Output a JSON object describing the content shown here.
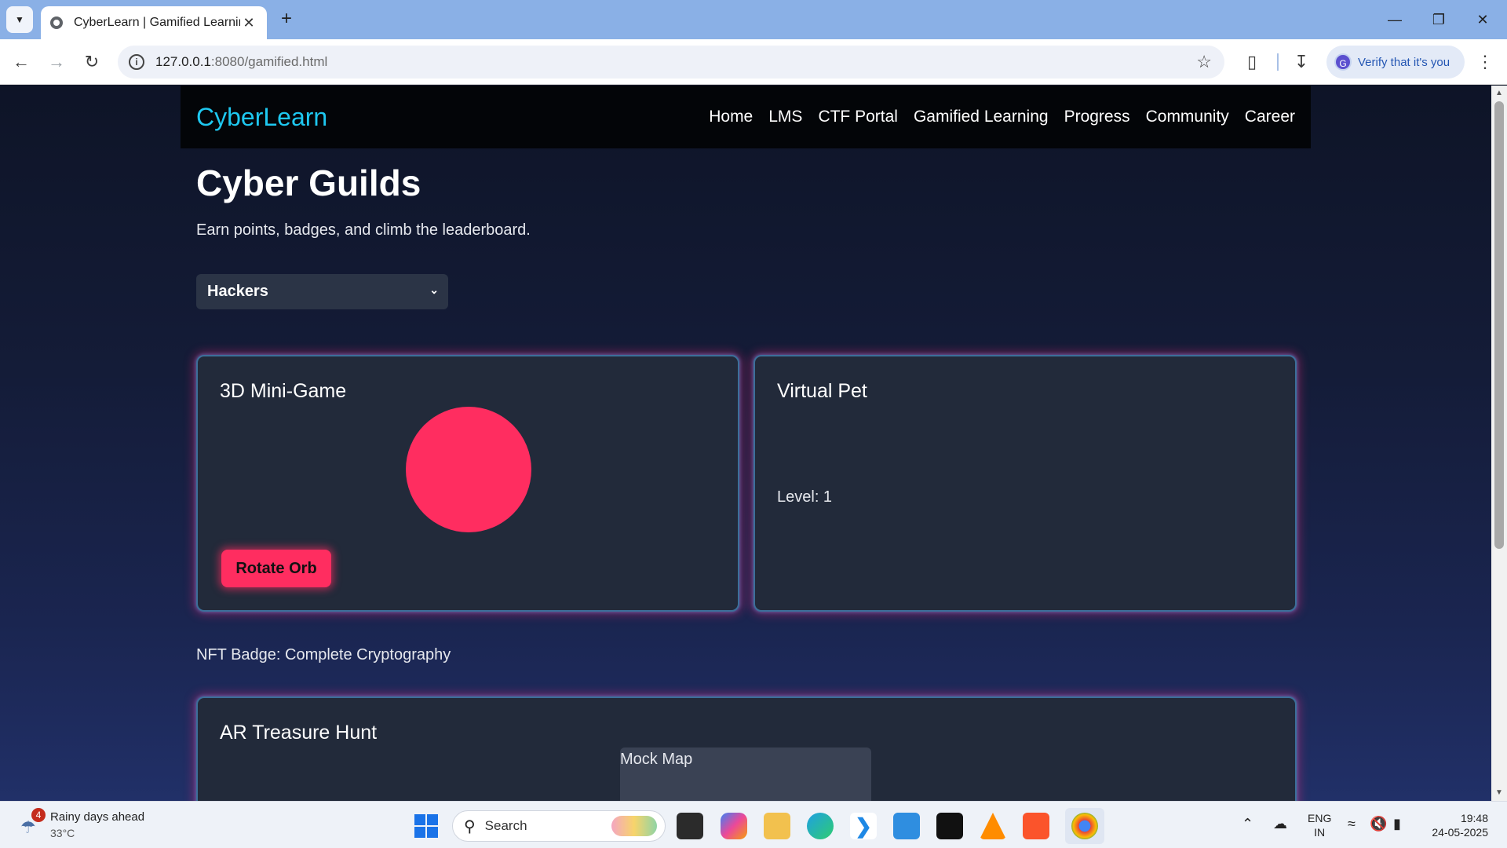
{
  "browser": {
    "tab_title": "CyberLearn | Gamified Learning",
    "url_host": "127.0.0.1",
    "url_path": ":8080/gamified.html",
    "profile_chip": "Verify that it's you",
    "profile_initial": "G"
  },
  "site": {
    "logo": "CyberLearn",
    "nav": [
      "Home",
      "LMS",
      "CTF Portal",
      "Gamified Learning",
      "Progress",
      "Community",
      "Career"
    ]
  },
  "page": {
    "title": "Cyber Guilds",
    "subtitle": "Earn points, badges, and climb the leaderboard.",
    "guild_select": "Hackers",
    "minigame": {
      "title": "3D Mini-Game",
      "button": "Rotate Orb",
      "orb_color": "#ff2d60"
    },
    "pet": {
      "title": "Virtual Pet",
      "level": "Level: 1"
    },
    "nft_badge": "NFT Badge: Complete Cryptography",
    "treasure": {
      "title": "AR Treasure Hunt",
      "map_label": "Mock Map"
    }
  },
  "taskbar": {
    "weather_text": "Rainy days ahead",
    "weather_temp": "33°C",
    "weather_badge": "4",
    "search_label": "Search",
    "lang_top": "ENG",
    "lang_bottom": "IN",
    "time": "19:48",
    "date": "24-05-2025"
  },
  "colors": {
    "accent_logo": "#1ec8f0",
    "accent_pink": "#ff2d60",
    "card_bg": "#222a3a"
  }
}
